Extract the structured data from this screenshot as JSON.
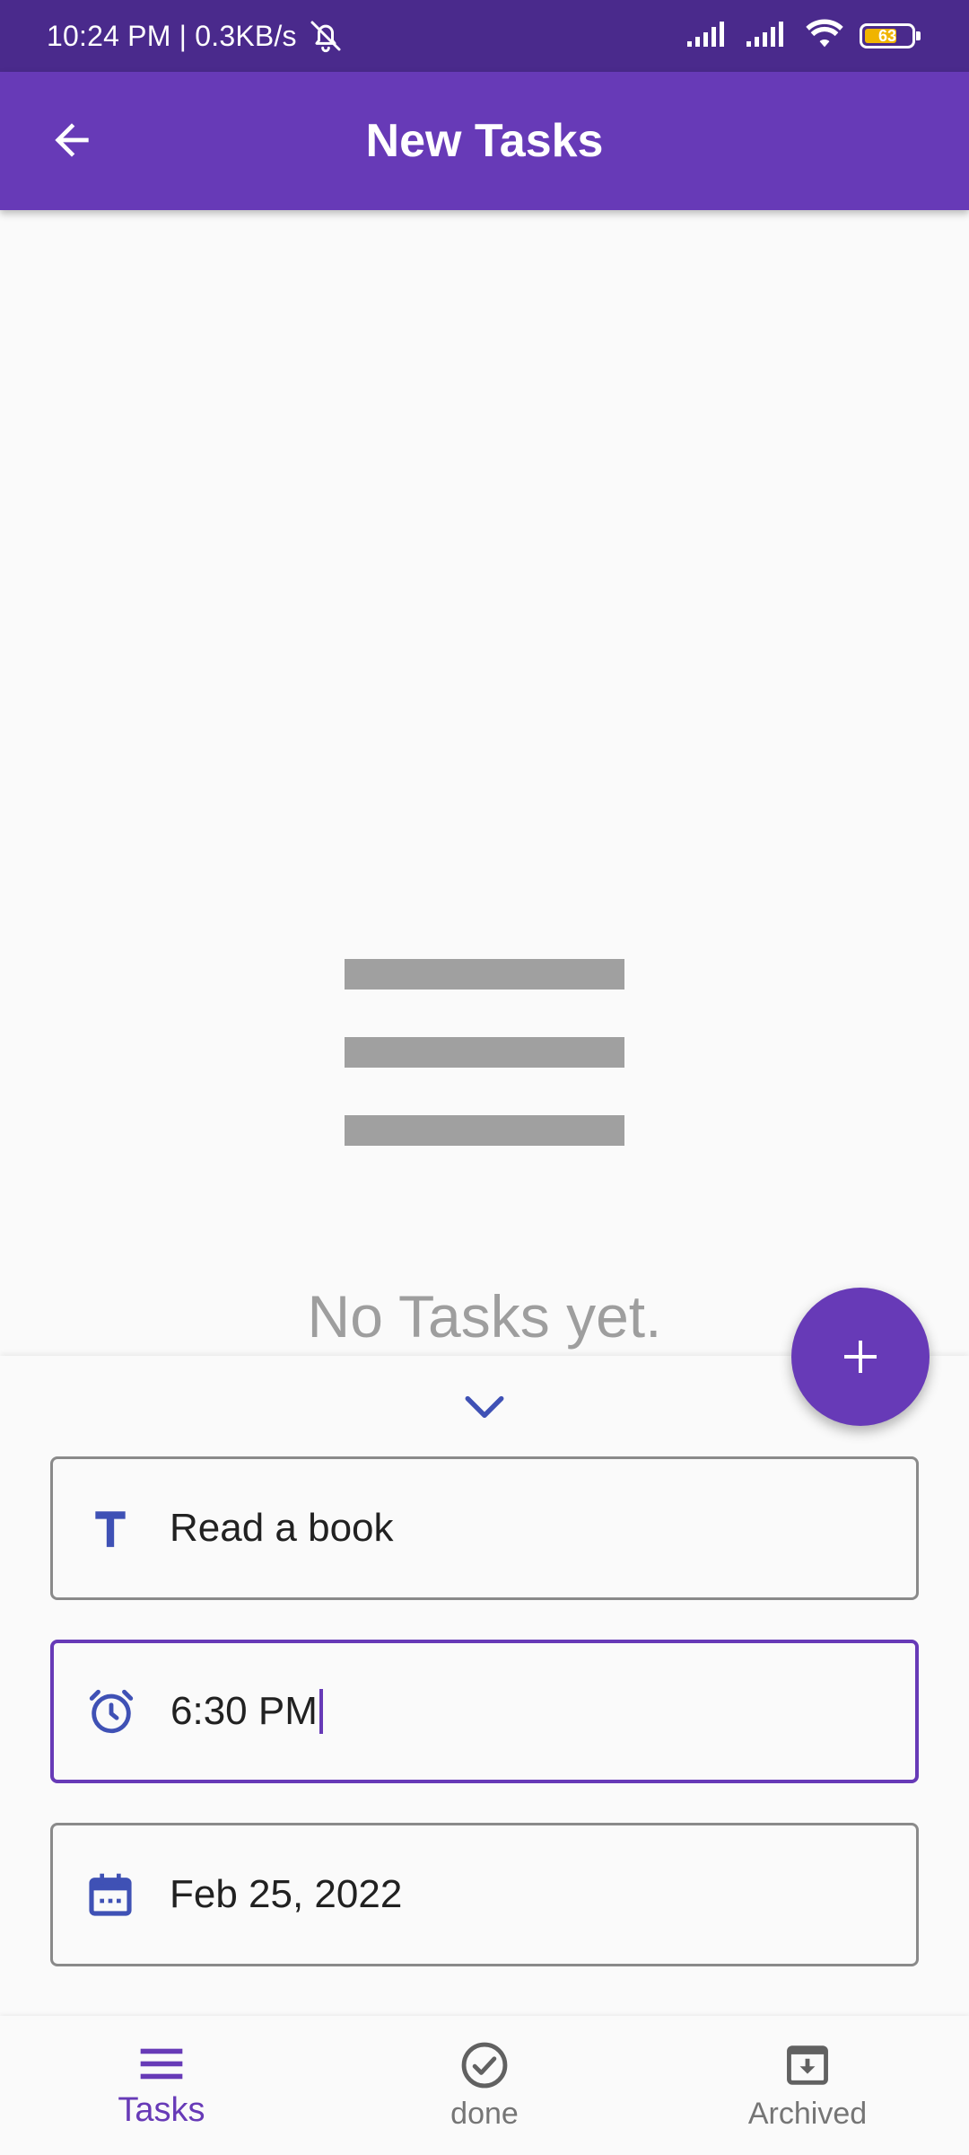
{
  "status_bar": {
    "time_info": "10:24 PM | 0.3KB/s",
    "battery_level": "63"
  },
  "app_bar": {
    "title": "New Tasks"
  },
  "empty_state": {
    "message": "No Tasks yet."
  },
  "form": {
    "title_field": {
      "value": "Read a book",
      "icon": "title-icon"
    },
    "time_field": {
      "value": "6:30 PM",
      "icon": "alarm-icon"
    },
    "date_field": {
      "value": "Feb 25, 2022",
      "icon": "calendar-icon"
    }
  },
  "bottom_nav": {
    "items": [
      {
        "label": "Tasks",
        "icon": "menu-icon",
        "active": true
      },
      {
        "label": "done",
        "icon": "check-circle-icon",
        "active": false
      },
      {
        "label": "Archived",
        "icon": "archive-icon",
        "active": false
      }
    ]
  },
  "colors": {
    "primary": "#673ab7",
    "status_bar": "#4a2a8c",
    "field_icon": "#3f51b5"
  }
}
